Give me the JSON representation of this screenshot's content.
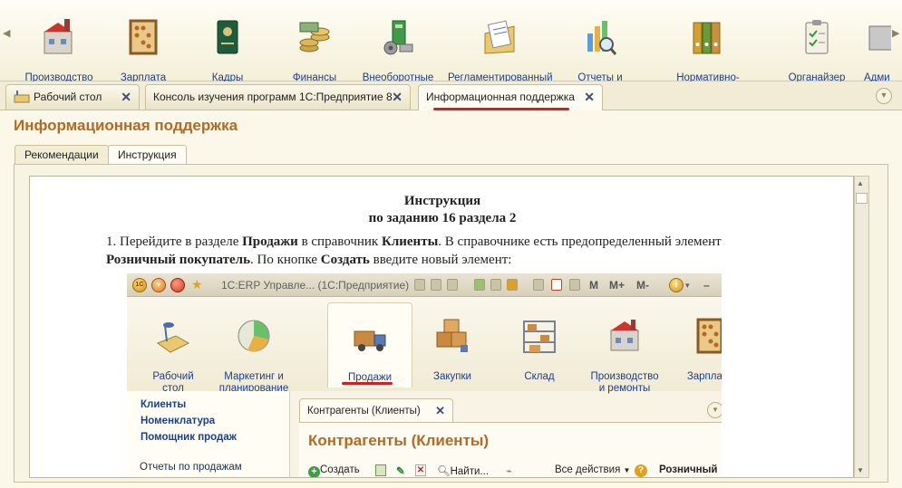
{
  "toolbar": {
    "sections": [
      {
        "label": "Производство\nи ремонты",
        "icon": "factory-icon"
      },
      {
        "label": "Зарплата",
        "icon": "abacus-icon"
      },
      {
        "label": "Кадры",
        "icon": "personnel-book-icon"
      },
      {
        "label": "Финансы",
        "icon": "coins-icon"
      },
      {
        "label": "Внеоборотные\nактивы",
        "icon": "assets-icon"
      },
      {
        "label": "Регламентированный\nучет",
        "icon": "reports-folder-icon"
      },
      {
        "label": "Отчеты и\nмониторинг",
        "icon": "chart-magnifier-icon"
      },
      {
        "label": "Нормативно-справочная\nинформация",
        "icon": "binders-icon"
      },
      {
        "label": "Органайзер",
        "icon": "checklist-icon"
      },
      {
        "label": "Адми",
        "icon": "admin-icon"
      }
    ]
  },
  "tabs": [
    {
      "label": "Рабочий стол",
      "icon": "desktop-icon"
    },
    {
      "label": "Консоль изучения программ 1С:Предприятие 8"
    },
    {
      "label": "Информационная поддержка"
    }
  ],
  "page": {
    "title": "Информационная поддержка"
  },
  "subtabs": [
    {
      "label": "Рекомендации"
    },
    {
      "label": "Инструкция"
    }
  ],
  "document": {
    "heading1": "Инструкция",
    "heading2": "по заданию 16 раздела 2",
    "p_start": "1. Перейдите в разделе ",
    "p_b1": "Продажи",
    "p_mid1": " в справочник ",
    "p_b2": "Клиенты",
    "p_mid2": ". В справочнике есть предопределенный элемент ",
    "p_b3": "Розничный покупатель",
    "p_mid3": ". По кнопке ",
    "p_b4": "Создать",
    "p_end": " введите новый элемент:"
  },
  "screenshot": {
    "window_title": "1С:ERP Управле... (1С:Предприятие)",
    "toolbar_items": [
      "M",
      "M+",
      "M-"
    ],
    "sections": [
      {
        "label": "Рабочий\nстол"
      },
      {
        "label": "Маркетинг и\nпланирование"
      },
      {
        "label": "Продажи"
      },
      {
        "label": "Закупки"
      },
      {
        "label": "Склад"
      },
      {
        "label": "Производство\nи ремонты"
      },
      {
        "label": "Зарплата"
      }
    ],
    "nav": [
      "Клиенты",
      "Номенклатура",
      "Помощник продаж",
      "Отчеты по продажам"
    ],
    "tab_label": "Контрагенты (Клиенты)",
    "form_title": "Контрагенты (Клиенты)",
    "commands": {
      "create": "Создать",
      "find": "Найти...",
      "all_actions": "Все действия",
      "partial": "Розничный"
    }
  },
  "colors": {
    "accent": "#b8681f",
    "link": "#1a3f8f",
    "underline": "#e01a1a"
  }
}
